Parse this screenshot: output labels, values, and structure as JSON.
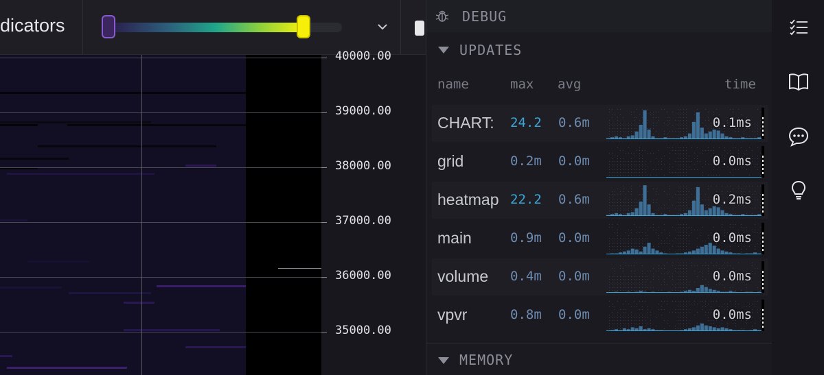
{
  "toolbar": {
    "indicators_label": "dicators"
  },
  "price_axis": {
    "ticks": [
      "40000.00",
      "39000.00",
      "38000.00",
      "37000.00",
      "36000.00",
      "35000.00"
    ]
  },
  "debug": {
    "title": "DEBUG",
    "updates_section": "UPDATES",
    "memory_section": "MEMORY",
    "columns": {
      "name": "name",
      "max": "max",
      "avg": "avg",
      "time": "time"
    },
    "rows": [
      {
        "name": "CHART:",
        "max": "24.2",
        "avg": "0.6m",
        "time": "0.1ms",
        "max_highlight": true
      },
      {
        "name": "grid",
        "max": "0.2m",
        "avg": "0.0m",
        "time": "0.0ms",
        "max_highlight": false
      },
      {
        "name": "heatmap",
        "max": "22.2",
        "avg": "0.6m",
        "time": "0.2ms",
        "max_highlight": true
      },
      {
        "name": "main",
        "max": "0.9m",
        "avg": "0.0m",
        "time": "0.0ms",
        "max_highlight": false
      },
      {
        "name": "volume",
        "max": "0.4m",
        "avg": "0.0m",
        "time": "0.0ms",
        "max_highlight": false
      },
      {
        "name": "vpvr",
        "max": "0.8m",
        "avg": "0.0m",
        "time": "0.0ms",
        "max_highlight": false
      }
    ]
  },
  "sidebar": {
    "icons": [
      "checklist-icon",
      "book-icon",
      "chat-icon",
      "lightbulb-icon"
    ]
  },
  "colors": {
    "highlight": "#3aa6d8",
    "muted_value": "#6e8bb0",
    "spark_bar": "#3d6f97",
    "gradient_end": "#f5f10c"
  }
}
